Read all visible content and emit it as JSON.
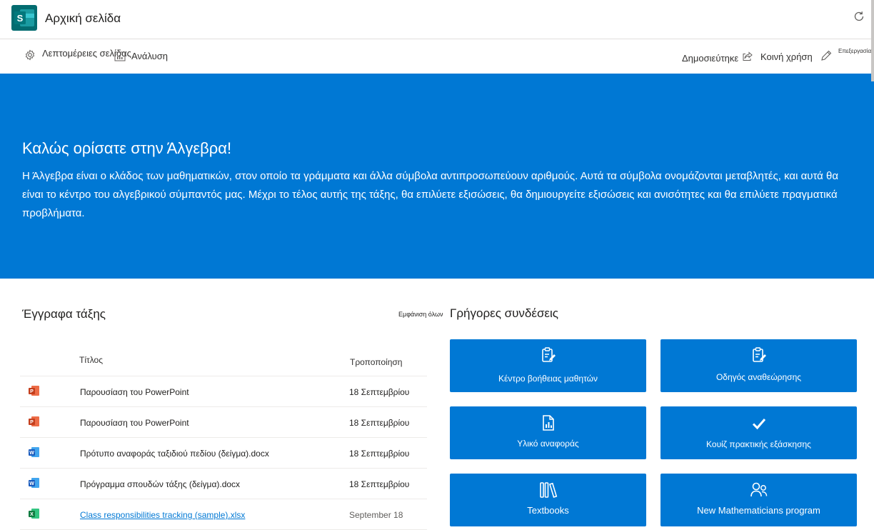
{
  "app": {
    "title": "Αρχική σελίδα",
    "logo_letter": "S"
  },
  "commands": {
    "page_details": "Λεπτομέρειες σελίδας",
    "analytics": "Ανάλυση",
    "published": "Δημοσιεύτηκε",
    "share": "Κοινή χρήση",
    "edit": "Επεξεργασία"
  },
  "hero": {
    "title": "Καλώς ορίσατε στην Άλγεβρα!",
    "text": "Η Άλγεβρα είναι ο κλάδος των μαθηματικών, στον οποίο τα γράμματα και άλλα σύμβολα αντιπροσωπεύουν αριθμούς. Αυτά τα σύμβολα ονομάζονται μεταβλητές, και αυτά θα είναι το κέντρο του αλγεβρικού σύμπαντός μας. Μέχρι το τέλος αυτής της τάξης, θα επιλύετε εξισώσεις, θα δημιουργείτε εξισώσεις και ανισότητες και θα επιλύετε πραγματικά προβλήματα."
  },
  "documents": {
    "title": "Έγγραφα τάξης",
    "show_all": "Εμφάνιση όλων",
    "columns": {
      "title": "Τίτλος",
      "modified": "Τροποποίηση"
    },
    "rows": [
      {
        "type": "powerpoint",
        "name": "Παρουσίαση του PowerPoint",
        "date": "18 Σεπτεμβρίου"
      },
      {
        "type": "powerpoint",
        "name": "Παρουσίαση του PowerPoint",
        "date": "18 Σεπτεμβρίου"
      },
      {
        "type": "word",
        "name": "Πρότυπο αναφοράς ταξιδιού πεδίου (δείγμα).docx",
        "date": "18 Σεπτεμβρίου"
      },
      {
        "type": "word",
        "name": "Πρόγραμμα σπουδών τάξης (δείγμα).docx",
        "date": "18 Σεπτεμβρίου"
      },
      {
        "type": "excel",
        "name": "Class responsibilities tracking (sample).xlsx",
        "date": "September 18"
      }
    ]
  },
  "quick_links": {
    "title": "Γρήγορες συνδέσεις",
    "tiles": [
      {
        "icon": "clipboard-edit-icon",
        "label": "Κέντρο βοήθειας μαθητών"
      },
      {
        "icon": "clipboard-edit-icon",
        "label": "Οδηγός αναθεώρησης"
      },
      {
        "icon": "document-chart-icon",
        "label": "Υλικό αναφοράς"
      },
      {
        "icon": "checkmark-icon",
        "label": "Κουίζ πρακτικής εξάσκησης"
      },
      {
        "icon": "library-books-icon",
        "label": "Textbooks"
      },
      {
        "icon": "people-icon",
        "label": "New Mathematicians program"
      }
    ]
  },
  "colors": {
    "accent": "#0078d4",
    "powerpoint": "#c43e1c",
    "word": "#185abd",
    "excel": "#107c41",
    "sharepoint_dark": "#036c70"
  }
}
